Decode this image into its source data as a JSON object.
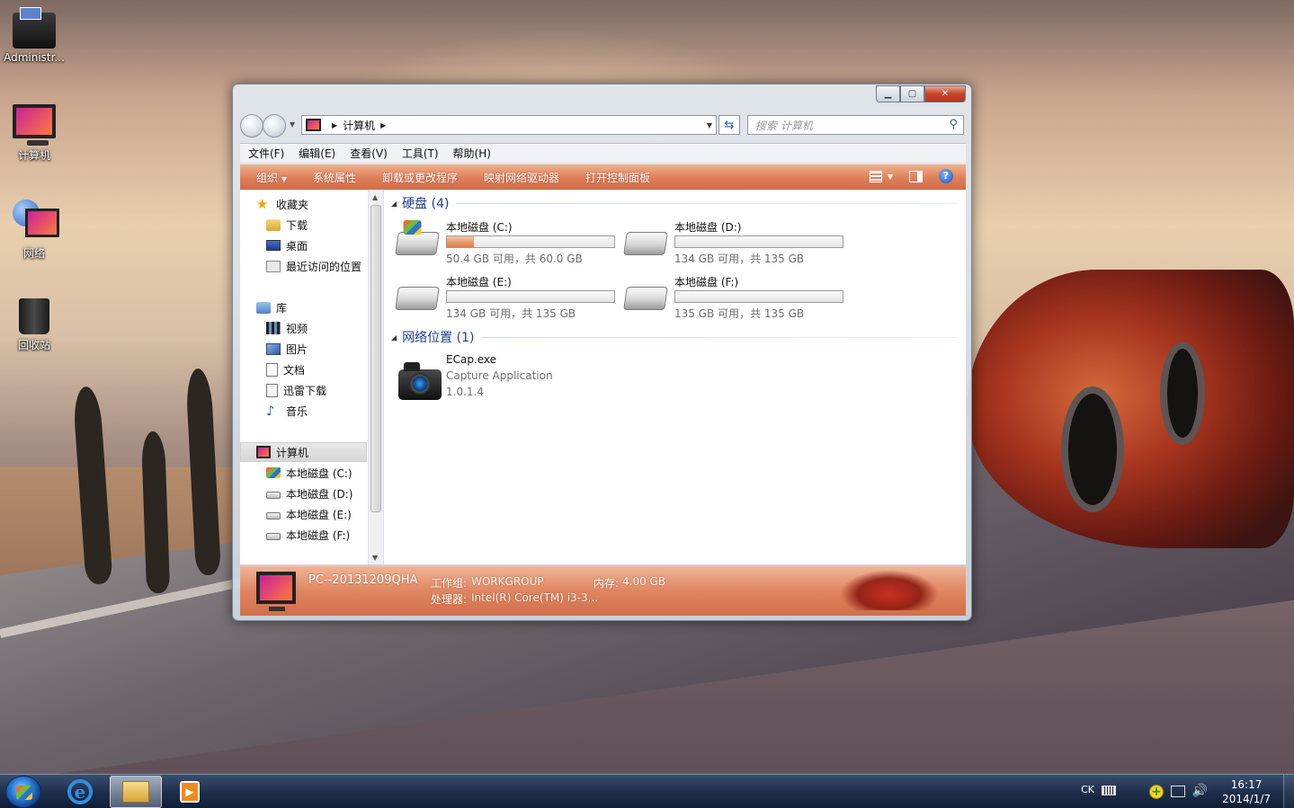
{
  "desktop": {
    "icons": [
      {
        "label": "Administr..."
      },
      {
        "label": "计算机"
      },
      {
        "label": "网络"
      },
      {
        "label": "回收站"
      }
    ]
  },
  "window": {
    "address": {
      "crumb": "计算机"
    },
    "search": {
      "placeholder": "搜索 计算机"
    },
    "menu": [
      "文件(F)",
      "编辑(E)",
      "查看(V)",
      "工具(T)",
      "帮助(H)"
    ],
    "toolbar": [
      "组织",
      "系统属性",
      "卸载或更改程序",
      "映射网络驱动器",
      "打开控制面板"
    ],
    "toolbar_arrow": "▼",
    "help_glyph": "?",
    "nav": {
      "favorites": {
        "label": "收藏夹",
        "items": [
          "下载",
          "桌面",
          "最近访问的位置"
        ]
      },
      "libraries": {
        "label": "库",
        "items": [
          "视频",
          "图片",
          "文档",
          "迅雷下载",
          "音乐"
        ]
      },
      "computer": {
        "label": "计算机",
        "items": [
          "本地磁盘 (C:)",
          "本地磁盘 (D:)",
          "本地磁盘 (E:)",
          "本地磁盘 (F:)"
        ]
      }
    },
    "groups": {
      "hard_disks": "硬盘 (4)",
      "network": "网络位置 (1)"
    },
    "drives": [
      {
        "name": "本地磁盘 (C:)",
        "free": "50.4 GB 可用，共 60.0 GB",
        "used_fraction": 0.16
      },
      {
        "name": "本地磁盘 (D:)",
        "free": "134 GB 可用，共 135 GB",
        "used_fraction": 0.0
      },
      {
        "name": "本地磁盘 (E:)",
        "free": "134 GB 可用，共 135 GB",
        "used_fraction": 0.0
      },
      {
        "name": "本地磁盘 (F:)",
        "free": "135 GB 可用，共 135 GB",
        "used_fraction": 0.0
      }
    ],
    "app": {
      "name": "ECap.exe",
      "desc": "Capture Application",
      "version": "1.0.1.4"
    },
    "details": {
      "pc_name": "PC--20131209QHA",
      "workgroup_label": "工作组:",
      "workgroup": "WORKGROUP",
      "memory_label": "内存:",
      "memory": "4.00 GB",
      "cpu_label": "处理器:",
      "cpu": "Intel(R) Core(TM) i3-3..."
    }
  },
  "taskbar": {
    "lang": "CK",
    "time": "16:17",
    "date": "2014/1/7",
    "ie_glyph": "e",
    "player_glyph": "▶"
  }
}
